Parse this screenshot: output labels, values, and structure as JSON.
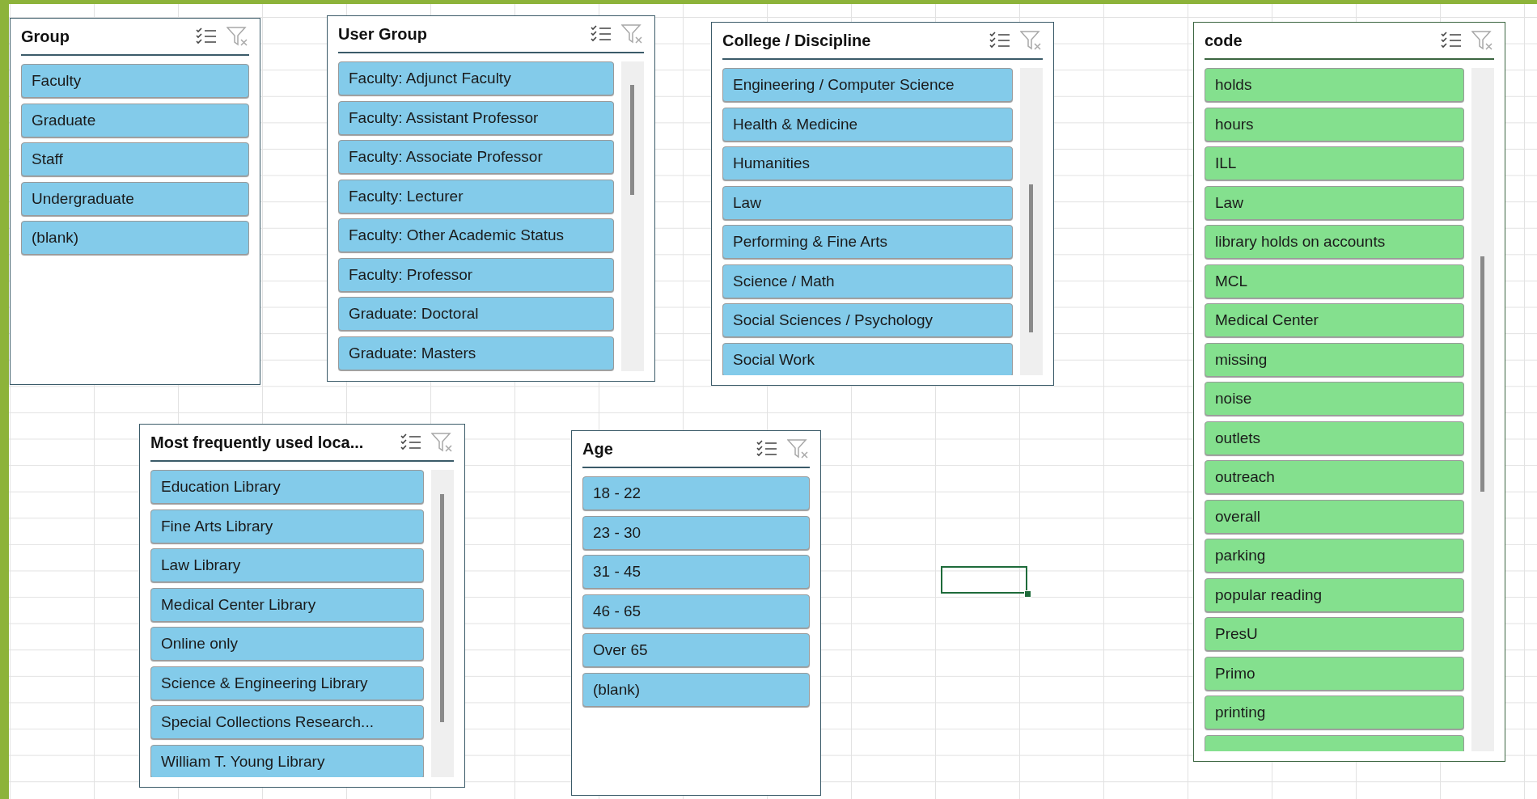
{
  "slicers": [
    {
      "title": "Group",
      "color": "#83cbea",
      "scrollable": false,
      "more_below": false,
      "items": [
        {
          "label": "Faculty",
          "selected": true
        },
        {
          "label": "Graduate",
          "selected": true
        },
        {
          "label": "Staff",
          "selected": true
        },
        {
          "label": "Undergraduate",
          "selected": true
        },
        {
          "label": "(blank)",
          "selected": true
        }
      ]
    },
    {
      "title": "User Group",
      "color": "#83cbea",
      "scrollable": true,
      "more_below": false,
      "items": [
        {
          "label": "Faculty: Adjunct Faculty",
          "selected": true
        },
        {
          "label": "Faculty: Assistant Professor",
          "selected": true
        },
        {
          "label": "Faculty: Associate Professor",
          "selected": true
        },
        {
          "label": "Faculty: Lecturer",
          "selected": true
        },
        {
          "label": "Faculty: Other Academic Status",
          "selected": true
        },
        {
          "label": "Faculty: Professor",
          "selected": true
        },
        {
          "label": "Graduate: Doctoral",
          "selected": true
        },
        {
          "label": "Graduate: Masters",
          "selected": true
        }
      ]
    },
    {
      "title": "College / Discipline",
      "color": "#83cbea",
      "scrollable": true,
      "more_below": false,
      "items": [
        {
          "label": "Engineering / Computer Science",
          "selected": true
        },
        {
          "label": "Health & Medicine",
          "selected": true
        },
        {
          "label": "Humanities",
          "selected": true
        },
        {
          "label": "Law",
          "selected": true
        },
        {
          "label": "Performing & Fine Arts",
          "selected": true
        },
        {
          "label": "Science / Math",
          "selected": true
        },
        {
          "label": "Social Sciences / Psychology",
          "selected": true
        },
        {
          "label": "Social Work",
          "selected": true
        }
      ]
    },
    {
      "title": "code",
      "color": "#84e08e",
      "scrollable": true,
      "more_below": true,
      "items": [
        {
          "label": "holds",
          "selected": true
        },
        {
          "label": "hours",
          "selected": true
        },
        {
          "label": "ILL",
          "selected": true
        },
        {
          "label": "Law",
          "selected": true
        },
        {
          "label": "library holds on accounts",
          "selected": true
        },
        {
          "label": "MCL",
          "selected": true
        },
        {
          "label": "Medical Center",
          "selected": true
        },
        {
          "label": "missing",
          "selected": true
        },
        {
          "label": "noise",
          "selected": true
        },
        {
          "label": "outlets",
          "selected": true
        },
        {
          "label": "outreach",
          "selected": true
        },
        {
          "label": "overall",
          "selected": true
        },
        {
          "label": "parking",
          "selected": true
        },
        {
          "label": "popular reading",
          "selected": true
        },
        {
          "label": "PresU",
          "selected": true
        },
        {
          "label": "Primo",
          "selected": true
        },
        {
          "label": "printing",
          "selected": true
        }
      ]
    },
    {
      "title": "Most frequently used loca...",
      "color": "#83cbea",
      "scrollable": true,
      "more_below": false,
      "items": [
        {
          "label": "Education Library",
          "selected": true
        },
        {
          "label": "Fine Arts Library",
          "selected": true
        },
        {
          "label": "Law Library",
          "selected": true
        },
        {
          "label": "Medical Center Library",
          "selected": true
        },
        {
          "label": "Online only",
          "selected": true
        },
        {
          "label": "Science & Engineering Library",
          "selected": true
        },
        {
          "label": "Special Collections Research...",
          "selected": true
        },
        {
          "label": "William T. Young Library",
          "selected": true
        }
      ]
    },
    {
      "title": "Age",
      "color": "#83cbea",
      "scrollable": false,
      "more_below": false,
      "items": [
        {
          "label": "18 - 22",
          "selected": true
        },
        {
          "label": "23 - 30",
          "selected": true
        },
        {
          "label": "31 - 45",
          "selected": true
        },
        {
          "label": "46 - 65",
          "selected": true
        },
        {
          "label": "Over 65",
          "selected": true
        },
        {
          "label": "(blank)",
          "selected": true
        }
      ]
    }
  ]
}
